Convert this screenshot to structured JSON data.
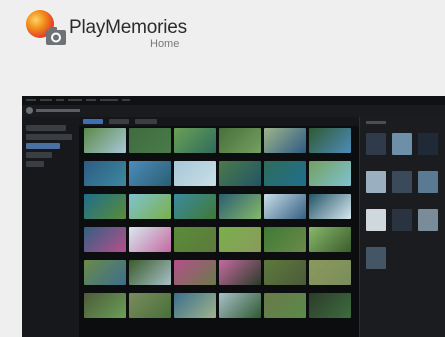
{
  "brand": {
    "title": "PlayMemories",
    "subtitle": "Home"
  },
  "colors": {
    "accent": "#3d6fb5",
    "logo_orange": "#f29019",
    "logo_red": "#e0322b",
    "background": "#efefef",
    "app_background": "#0f1012"
  },
  "icons": {
    "logo": "playmemories-camera-icon",
    "app": "app-icon"
  },
  "screenshot": {
    "sidebar_items": [
      "item-1",
      "item-2",
      "item-3",
      "item-4",
      "item-5"
    ],
    "tabs": [
      "tab-1",
      "tab-2",
      "tab-3"
    ],
    "grid_rows": 6,
    "grid_cols": 6,
    "thumb_palette": [
      [
        "#5b8a49",
        "#3e6c3e",
        "#6aa056",
        "#486f3a",
        "#9fb48b",
        "#2f5a32"
      ],
      [
        "#2d5b84",
        "#4d8cba",
        "#a8c7d8",
        "#4b7a4a",
        "#2f6c5c",
        "#74a060"
      ],
      [
        "#1f6e8c",
        "#7fc2d2",
        "#3c8a9f",
        "#2a5f72",
        "#c8dfe6",
        "#225566"
      ],
      [
        "#355f84",
        "#d8e8f0",
        "#5a8c38",
        "#7ab04a",
        "#3f7a35",
        "#86b86a"
      ],
      [
        "#6b8a4a",
        "#3b5c2c",
        "#b4508a",
        "#c46aa0",
        "#5d7a3c",
        "#8a9a5c"
      ],
      [
        "#4d5a3a",
        "#7a8c5c",
        "#3c6e8c",
        "#a8c0c8",
        "#6a7a4a",
        "#2c3c2a"
      ]
    ],
    "right_panel_palette": [
      "#2f3b4a",
      "#6d8fa8",
      "#1f2a36",
      "#9ab0c0",
      "#3a4a5a",
      "#5a7a94",
      "#cfd8dc",
      "#2a3440",
      "#7a8c9a",
      "#445566"
    ]
  }
}
